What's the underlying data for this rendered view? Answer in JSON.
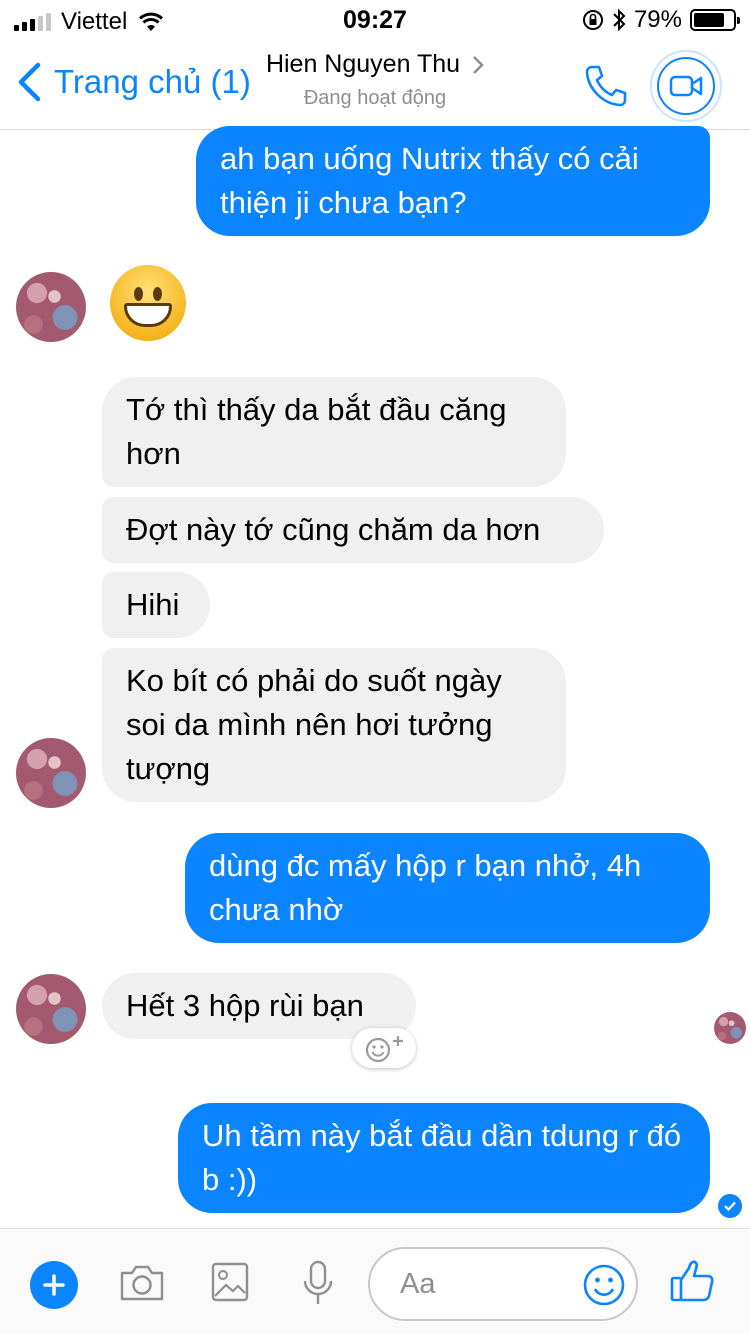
{
  "status_bar": {
    "carrier": "Viettel",
    "time": "09:27",
    "battery": "79%",
    "battery_level": 0.79
  },
  "header": {
    "back_label": "Trang chủ (1)",
    "contact_name": "Hien Nguyen Thu",
    "contact_status": "Đang hoạt động"
  },
  "messages": [
    {
      "from": "me",
      "text": "ah bạn uống Nutrix thấy có cải thiện ji chưa bạn?"
    },
    {
      "from": "them",
      "type": "emoji",
      "emoji": "grinning-face"
    },
    {
      "from": "them",
      "text": "Tớ thì thấy da bắt đầu căng hơn"
    },
    {
      "from": "them",
      "text": "Đợt này tớ cũng chăm da hơn"
    },
    {
      "from": "them",
      "text": "Hihi"
    },
    {
      "from": "them",
      "text": "Ko bít có phải do suốt ngày soi da mình nên hơi tưởng tượng"
    },
    {
      "from": "me",
      "text": "dùng đc mấy hộp r bạn nhở, 4h chưa nhờ"
    },
    {
      "from": "them",
      "text": "Hết 3 hộp rùi bạn"
    },
    {
      "from": "me",
      "text": "Uh tầm này bắt đầu dần tdung r đó b :))"
    }
  ],
  "composer": {
    "placeholder": "Aa",
    "icons": [
      "plus-icon",
      "camera-icon",
      "image-icon",
      "microphone-icon",
      "emoji-icon",
      "thumbs-up-icon"
    ]
  },
  "colors": {
    "accent": "#0b84ff",
    "incoming_bubble": "#f0f0f0",
    "outgoing_text": "#ffffff"
  }
}
